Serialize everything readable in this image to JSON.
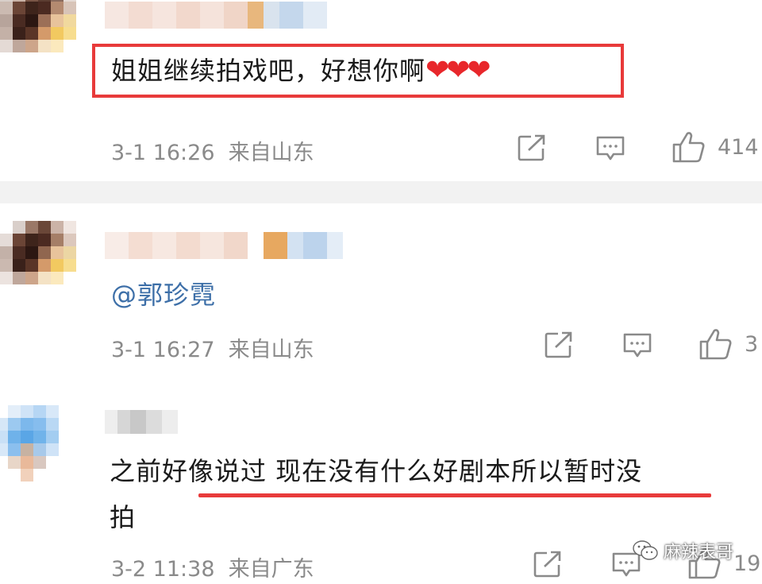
{
  "comments": [
    {
      "text": "姐姐继续拍戏吧，好想你啊",
      "hearts": "❤❤❤",
      "time": "3-1 16:26",
      "location": "来自山东",
      "likes": "414"
    },
    {
      "mention": "@郭珍霓",
      "time": "3-1 16:27",
      "location": "来自山东",
      "likes": "3"
    },
    {
      "text_line1": "之前好像说过 现在没有什么好剧本所以暂时没",
      "text_line2": "拍",
      "time": "3-2 11:38",
      "location": "来自广东",
      "likes": "19"
    }
  ],
  "watermark": {
    "label": "麻辣表哥"
  },
  "icons": {
    "share": "share-icon",
    "comment": "comment-icon",
    "like": "thumbs-up-icon",
    "watermark": "wechat-icon"
  },
  "colors": {
    "highlight": "#e83a3a",
    "mention": "#3d6fa8",
    "meta": "#8a8a8a",
    "divider": "#f2f2f2"
  }
}
